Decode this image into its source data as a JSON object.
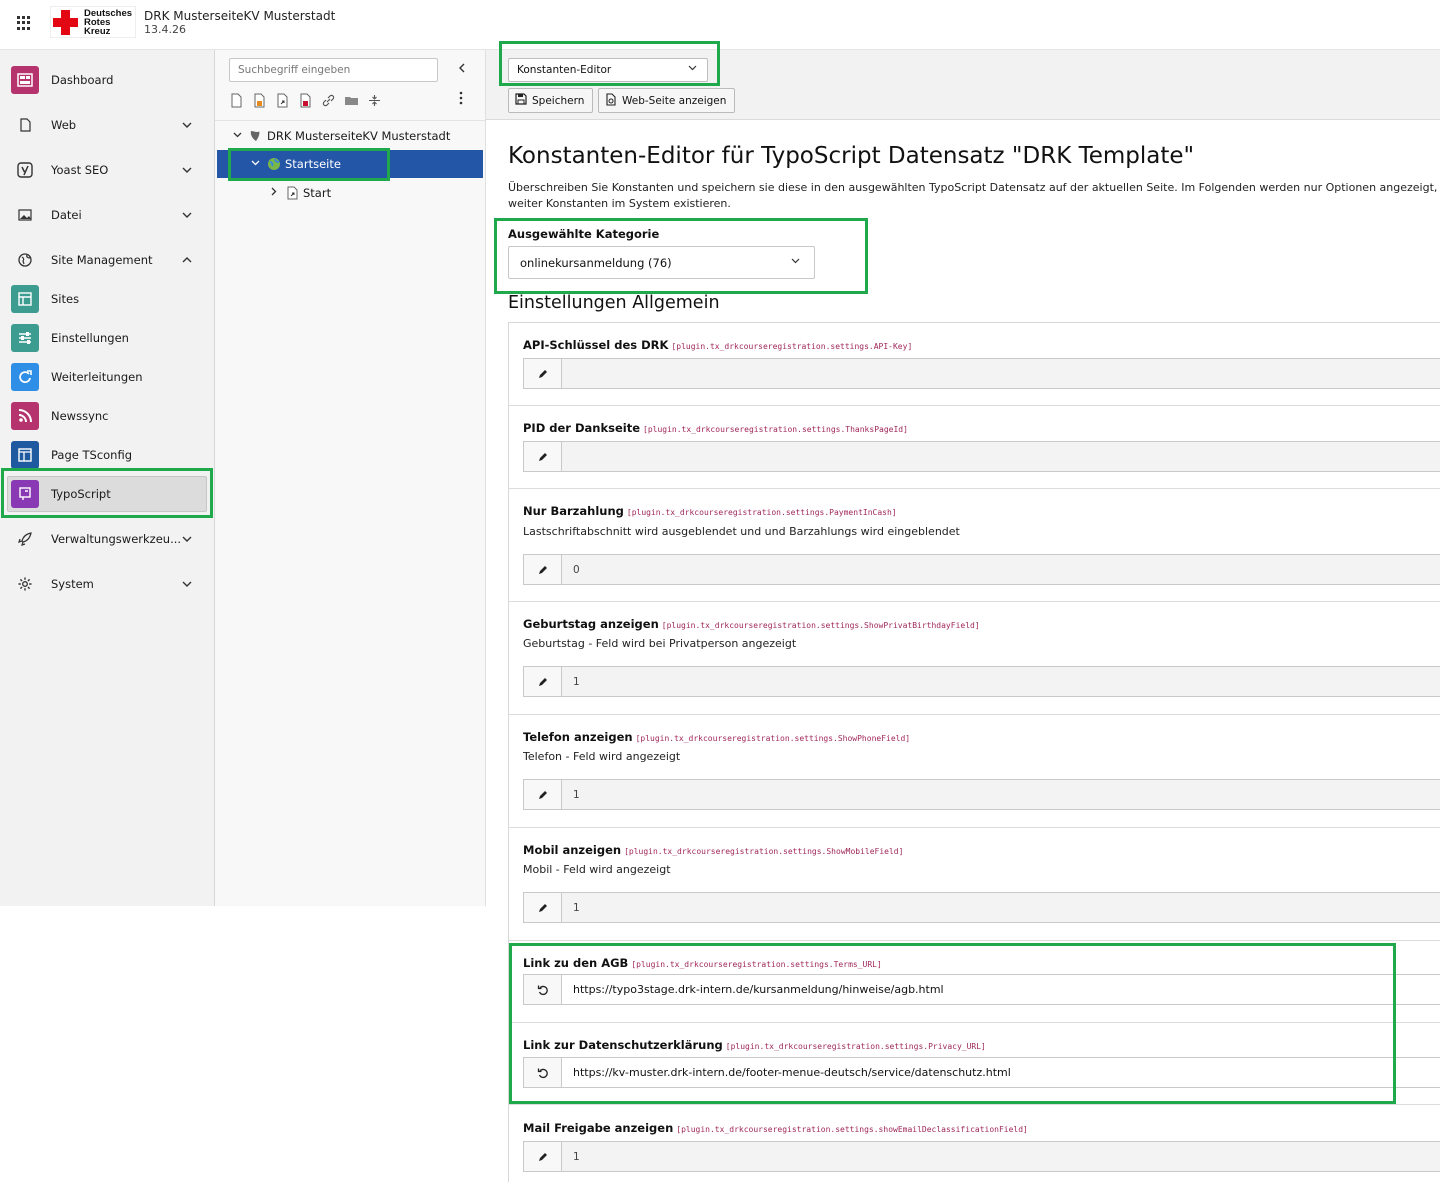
{
  "topbar": {
    "logo_line1": "Deutsches",
    "logo_line2": "Rotes",
    "logo_line3": "Kreuz",
    "site_name": "DRK MusterseiteKV Musterstadt",
    "version": "13.4.26"
  },
  "modules": [
    {
      "label": "Dashboard",
      "icon": "dashboard-icon",
      "color": "#b5346e"
    },
    {
      "label": "Web",
      "icon": "page-icon",
      "chevron": "down"
    },
    {
      "label": "Yoast SEO",
      "icon": "yoast-icon",
      "chevron": "down"
    },
    {
      "label": "Datei",
      "icon": "image-icon",
      "chevron": "down"
    },
    {
      "label": "Site Management",
      "icon": "globe-icon",
      "chevron": "up"
    },
    {
      "label": "Sites",
      "icon": "sites-icon",
      "color": "#3d9c90"
    },
    {
      "label": "Einstellungen",
      "icon": "settings-sliders-icon",
      "color": "#3d9c90"
    },
    {
      "label": "Weiterleitungen",
      "icon": "redirect-icon",
      "color": "#2f8ee6"
    },
    {
      "label": "Newssync",
      "icon": "rss-icon",
      "color": "#b5346e"
    },
    {
      "label": "Page TSconfig",
      "icon": "tsconfig-icon",
      "color": "#1f5aa0"
    },
    {
      "label": "TypoScript",
      "icon": "typoscript-icon",
      "color": "#8a39b5"
    },
    {
      "label": "Verwaltungswerkzeu...",
      "icon": "rocket-icon",
      "chevron": "down"
    },
    {
      "label": "System",
      "icon": "gear-icon",
      "chevron": "down"
    }
  ],
  "tree": {
    "search_placeholder": "Suchbegriff eingeben",
    "root": "DRK MusterseiteKV Musterstadt",
    "selected": "Startseite",
    "child": "Start"
  },
  "docheader": {
    "mode": "Konstanten-Editor",
    "save_label": "Speichern",
    "view_label": "Web-Seite anzeigen"
  },
  "content": {
    "title": "Konstanten-Editor für TypoScript Datensatz \"DRK Template\"",
    "description": "Überschreiben Sie Konstanten und speichern sie diese in den ausgewählten TypoScript Datensatz auf der aktuellen Seite. Im Folgenden werden nur Optionen angezeigt, die können weiter Konstanten im System existieren.",
    "category_label": "Ausgewählte Kategorie",
    "category_value": "onlinekursanmeldung (76)",
    "section_title": "Einstellungen Allgemein"
  },
  "constants": [
    {
      "label": "API-Schlüssel des DRK",
      "key": "[plugin.tx_drkcourseregistration.settings.API-Key]",
      "description": "",
      "value": "",
      "mode": "edit"
    },
    {
      "label": "PID der Dankseite",
      "key": "[plugin.tx_drkcourseregistration.settings.ThanksPageId]",
      "description": "",
      "value": "",
      "mode": "edit"
    },
    {
      "label": "Nur Barzahlung",
      "key": "[plugin.tx_drkcourseregistration.settings.PaymentInCash]",
      "description": "Lastschriftabschnitt wird ausgeblendet und und Barzahlungs wird eingeblendet",
      "value": "0",
      "mode": "edit"
    },
    {
      "label": "Geburtstag anzeigen",
      "key": "[plugin.tx_drkcourseregistration.settings.ShowPrivatBirthdayField]",
      "description": "Geburtstag - Feld wird bei Privatperson angezeigt",
      "value": "1",
      "mode": "edit"
    },
    {
      "label": "Telefon anzeigen",
      "key": "[plugin.tx_drkcourseregistration.settings.ShowPhoneField]",
      "description": "Telefon - Feld wird angezeigt",
      "value": "1",
      "mode": "edit"
    },
    {
      "label": "Mobil anzeigen",
      "key": "[plugin.tx_drkcourseregistration.settings.ShowMobileField]",
      "description": "Mobil - Feld wird angezeigt",
      "value": "1",
      "mode": "edit"
    },
    {
      "label": "Link zu den AGB",
      "key": "[plugin.tx_drkcourseregistration.settings.Terms_URL]",
      "description": "",
      "value": "https://typo3stage.drk-intern.de/kursanmeldung/hinweise/agb.html",
      "mode": "reset"
    },
    {
      "label": "Link zur Datenschutzerklärung",
      "key": "[plugin.tx_drkcourseregistration.settings.Privacy_URL]",
      "description": "",
      "value": "https://kv-muster.drk-intern.de/footer-menue-deutsch/service/datenschutz.html",
      "mode": "reset"
    },
    {
      "label": "Mail Freigabe anzeigen",
      "key": "[plugin.tx_drkcourseregistration.settings.showEmailDeclassificationField]",
      "description": "",
      "value": "1",
      "mode": "edit"
    }
  ],
  "colors": {
    "highlight": "#20a84d",
    "tree_selected": "#2456a7",
    "constant_key": "#a0285a",
    "drk_red": "#e30613"
  }
}
